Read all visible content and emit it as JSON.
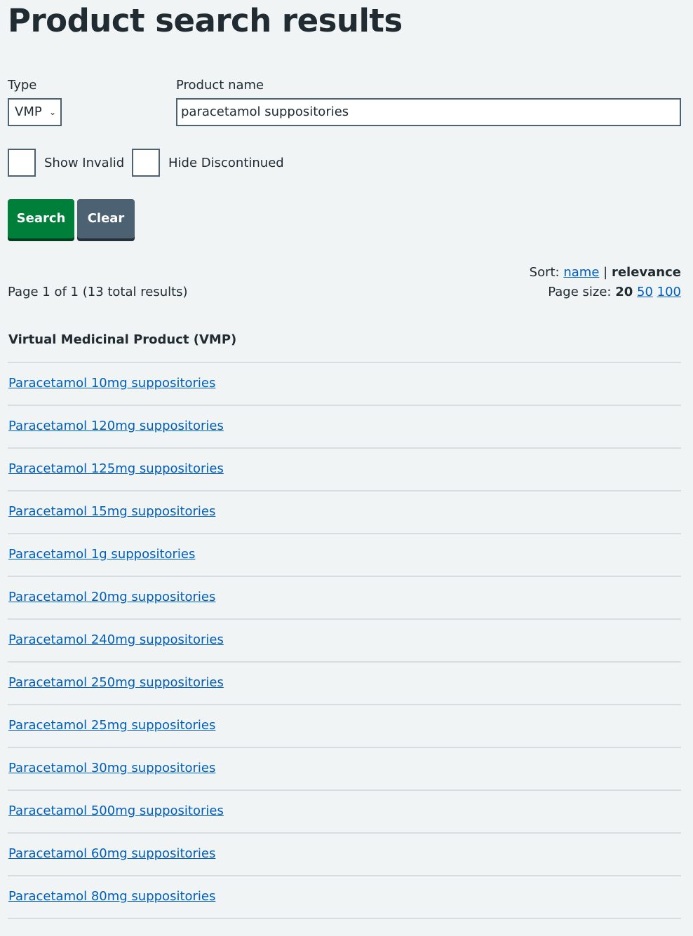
{
  "page_title": "Product search results",
  "form": {
    "type_label": "Type",
    "type_selected": "VMP",
    "product_name_label": "Product name",
    "product_name_value": "paracetamol suppositories",
    "show_invalid_label": "Show Invalid",
    "show_invalid_checked": false,
    "hide_discontinued_label": "Hide Discontinued",
    "hide_discontinued_checked": false,
    "search_label": "Search",
    "clear_label": "Clear"
  },
  "results_meta": {
    "page_info": "Page 1 of 1 (13 total results)",
    "sort_label": "Sort:",
    "sort_name": "name",
    "sort_separator": "|",
    "sort_relevance": "relevance",
    "page_size_label": "Page size:",
    "page_size_current": "20",
    "page_size_50": "50",
    "page_size_100": "100"
  },
  "section_heading": "Virtual Medicinal Product (VMP)",
  "results": [
    "Paracetamol 10mg suppositories",
    "Paracetamol 120mg suppositories",
    "Paracetamol 125mg suppositories",
    "Paracetamol 15mg suppositories",
    "Paracetamol 1g suppositories",
    "Paracetamol 20mg suppositories",
    "Paracetamol 240mg suppositories",
    "Paracetamol 250mg suppositories",
    "Paracetamol 25mg suppositories",
    "Paracetamol 30mg suppositories",
    "Paracetamol 500mg suppositories",
    "Paracetamol 60mg suppositories",
    "Paracetamol 80mg suppositories"
  ],
  "colors": {
    "background": "#f0f4f5",
    "text": "#212b32",
    "link": "#005eb8",
    "search_button": "#007f3b",
    "clear_button": "#4c6272",
    "divider": "#d8dde0"
  }
}
